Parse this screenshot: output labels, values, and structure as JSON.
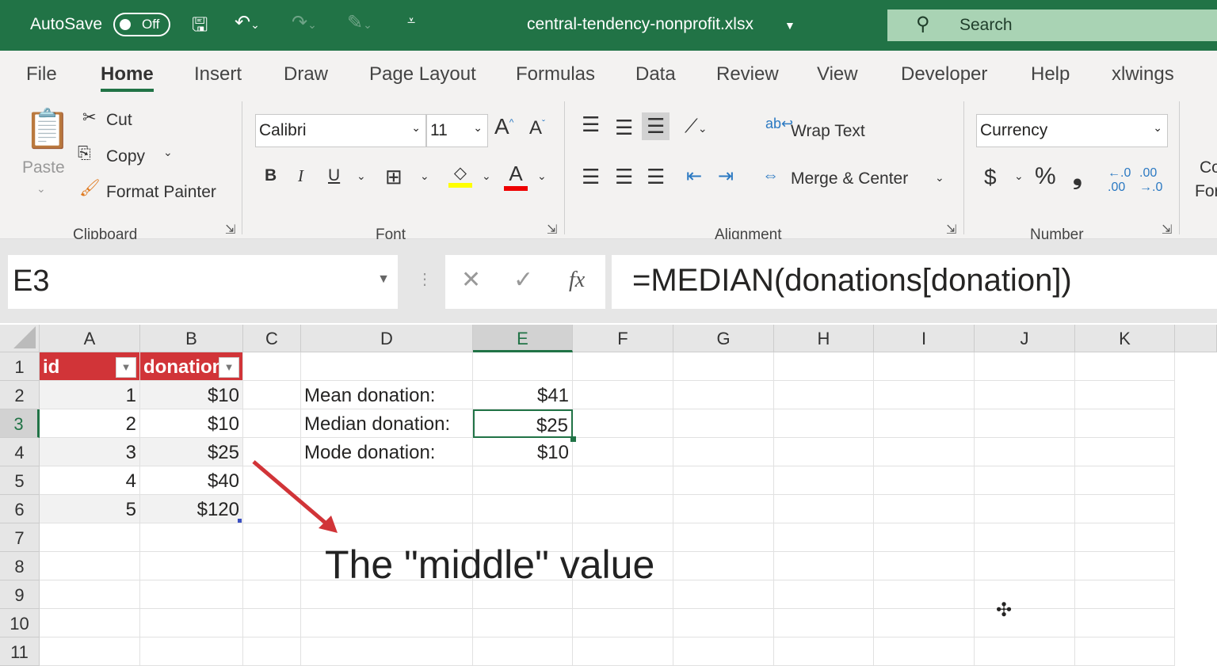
{
  "titlebar": {
    "autosave": "AutoSave",
    "toggle": "Off",
    "filename": "central-tendency-nonprofit.xlsx",
    "search": "Search"
  },
  "tabs": [
    "File",
    "Home",
    "Insert",
    "Draw",
    "Page Layout",
    "Formulas",
    "Data",
    "Review",
    "View",
    "Developer",
    "Help",
    "xlwings"
  ],
  "ribbon": {
    "paste": "Paste",
    "cut": "Cut",
    "copy": "Copy",
    "format_painter": "Format Painter",
    "clipboard": "Clipboard",
    "font_name": "Calibri",
    "font_size": "11",
    "font": "Font",
    "bold": "B",
    "italic": "I",
    "underline": "U",
    "wrap_text": "Wrap Text",
    "merge_center": "Merge & Center",
    "alignment": "Alignment",
    "number_format": "Currency",
    "currency": "$",
    "percent": "%",
    "comma": "❟",
    "number": "Number",
    "cond1": "Co",
    "cond2": "For"
  },
  "formula_bar": {
    "name_box": "E3",
    "fx": "fx",
    "formula": "=MEDIAN(donations[donation])"
  },
  "columns": [
    "A",
    "B",
    "C",
    "D",
    "E",
    "F",
    "G",
    "H",
    "I",
    "J",
    "K"
  ],
  "selected_column": "E",
  "selected_row": "3",
  "rows": [
    "1",
    "2",
    "3",
    "4",
    "5",
    "6",
    "7",
    "8",
    "9",
    "10",
    "11"
  ],
  "table": {
    "headers": [
      "id",
      "donation"
    ],
    "rows": [
      [
        "1",
        "$10"
      ],
      [
        "2",
        "$10"
      ],
      [
        "3",
        "$25"
      ],
      [
        "4",
        "$40"
      ],
      [
        "5",
        "$120"
      ]
    ]
  },
  "stats": [
    {
      "label": "Mean donation:",
      "value": "$41"
    },
    {
      "label": "Median donation:",
      "value": "$25"
    },
    {
      "label": "Mode donation:",
      "value": "$10"
    }
  ],
  "annotation": "The \"middle\" value",
  "colors": {
    "brand": "#217346",
    "table_header": "#d13438",
    "arrow": "#d13438"
  }
}
